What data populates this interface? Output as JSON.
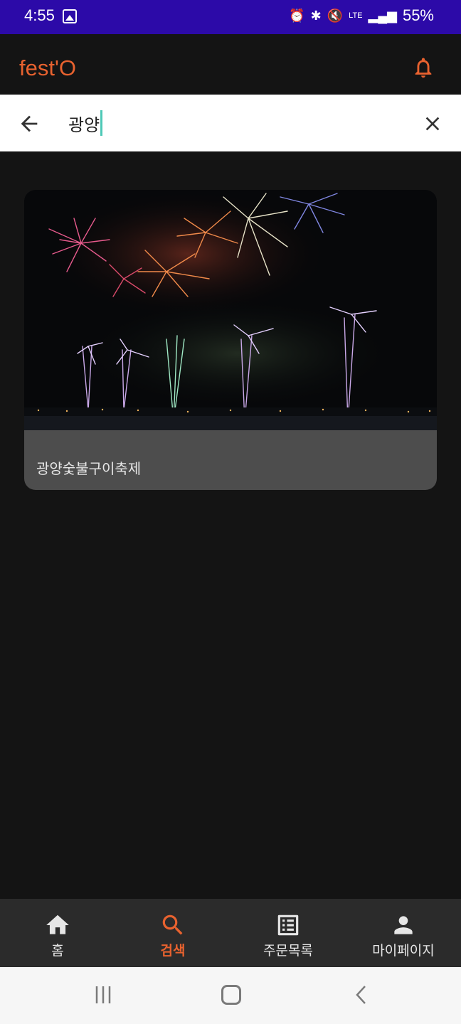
{
  "status_bar": {
    "time": "4:55",
    "battery": "55%",
    "network": "LTE",
    "icons": [
      "gallery-icon",
      "alarm-icon",
      "bluetooth-icon",
      "mute-icon",
      "lte-icon",
      "signal-icon"
    ]
  },
  "app_bar": {
    "title": "fest'O",
    "accent_color": "#e8622f",
    "notification_icon": "bell-icon"
  },
  "search": {
    "value": "광양",
    "back_icon": "back-arrow-icon",
    "clear_icon": "close-icon"
  },
  "results": [
    {
      "title": "광양숯불구이축제",
      "image": "fireworks-photo"
    }
  ],
  "bottom_nav": {
    "items": [
      {
        "label": "홈",
        "icon": "home-icon",
        "active": false
      },
      {
        "label": "검색",
        "icon": "search-icon",
        "active": true
      },
      {
        "label": "주문목록",
        "icon": "order-list-icon",
        "active": false
      },
      {
        "label": "마이페이지",
        "icon": "person-icon",
        "active": false
      }
    ]
  },
  "system_nav": {
    "icons": [
      "recent-apps-icon",
      "home-button-icon",
      "back-icon"
    ]
  }
}
